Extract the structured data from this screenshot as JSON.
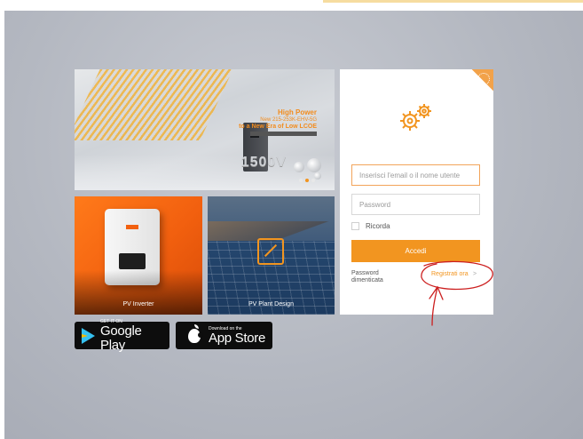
{
  "hero": {
    "line1": "High Power",
    "line2": "New 215-253K-EHV-5G",
    "line3": "to a New Era of Low LCOE",
    "big_text": "1500V"
  },
  "tiles": {
    "inverter_label": "PV Inverter",
    "plant_label": "PV Plant Design"
  },
  "badges": {
    "google_small": "GET IT ON",
    "google_big": "Google Play",
    "apple_small": "Download on the",
    "apple_big": "App Store"
  },
  "login": {
    "email_placeholder": "Inserisci l'email o il nome utente",
    "password_placeholder": "Password",
    "remember_label": "Ricorda",
    "login_button": "Accedi",
    "forgot_line1": "Password",
    "forgot_line2": "dimenticata",
    "register_link": "Registrati ora",
    "register_arrow": ">"
  },
  "colors": {
    "accent": "#f29520",
    "annotation": "#cc1f1f"
  }
}
